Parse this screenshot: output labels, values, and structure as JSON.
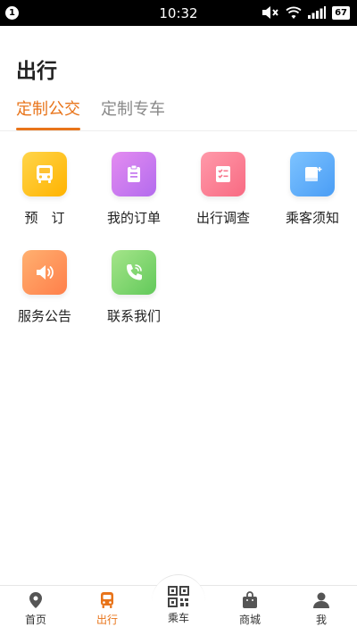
{
  "status_bar": {
    "notification_count": "1",
    "time": "10:32",
    "battery": "67"
  },
  "header": {
    "title": "出行"
  },
  "tabs": [
    {
      "label": "定制公交",
      "active": true
    },
    {
      "label": "定制专车",
      "active": false
    }
  ],
  "services": [
    {
      "label": "预　订",
      "icon": "bus-icon",
      "color_from": "#ffd54a",
      "color_to": "#ffb300"
    },
    {
      "label": "我的订单",
      "icon": "clipboard-icon",
      "color_from": "#e48cf0",
      "color_to": "#b36bee"
    },
    {
      "label": "出行调查",
      "icon": "checklist-icon",
      "color_from": "#ff9aaa",
      "color_to": "#f86a82"
    },
    {
      "label": "乘客须知",
      "icon": "notebook-icon",
      "color_from": "#7dc3ff",
      "color_to": "#4a9df5"
    },
    {
      "label": "服务公告",
      "icon": "speaker-icon",
      "color_from": "#ffb070",
      "color_to": "#ff7f4a"
    },
    {
      "label": "联系我们",
      "icon": "phone-icon",
      "color_from": "#a5e58a",
      "color_to": "#62c95a"
    }
  ],
  "bottom_nav": [
    {
      "label": "首页",
      "icon": "location-pin-icon",
      "active": false
    },
    {
      "label": "出行",
      "icon": "bus-icon",
      "active": true
    },
    {
      "label": "乘车",
      "icon": "qr-code-icon",
      "active": false
    },
    {
      "label": "商城",
      "icon": "shopping-bag-icon",
      "active": false
    },
    {
      "label": "我",
      "icon": "user-icon",
      "active": false
    }
  ],
  "colors": {
    "accent": "#e8741a"
  }
}
